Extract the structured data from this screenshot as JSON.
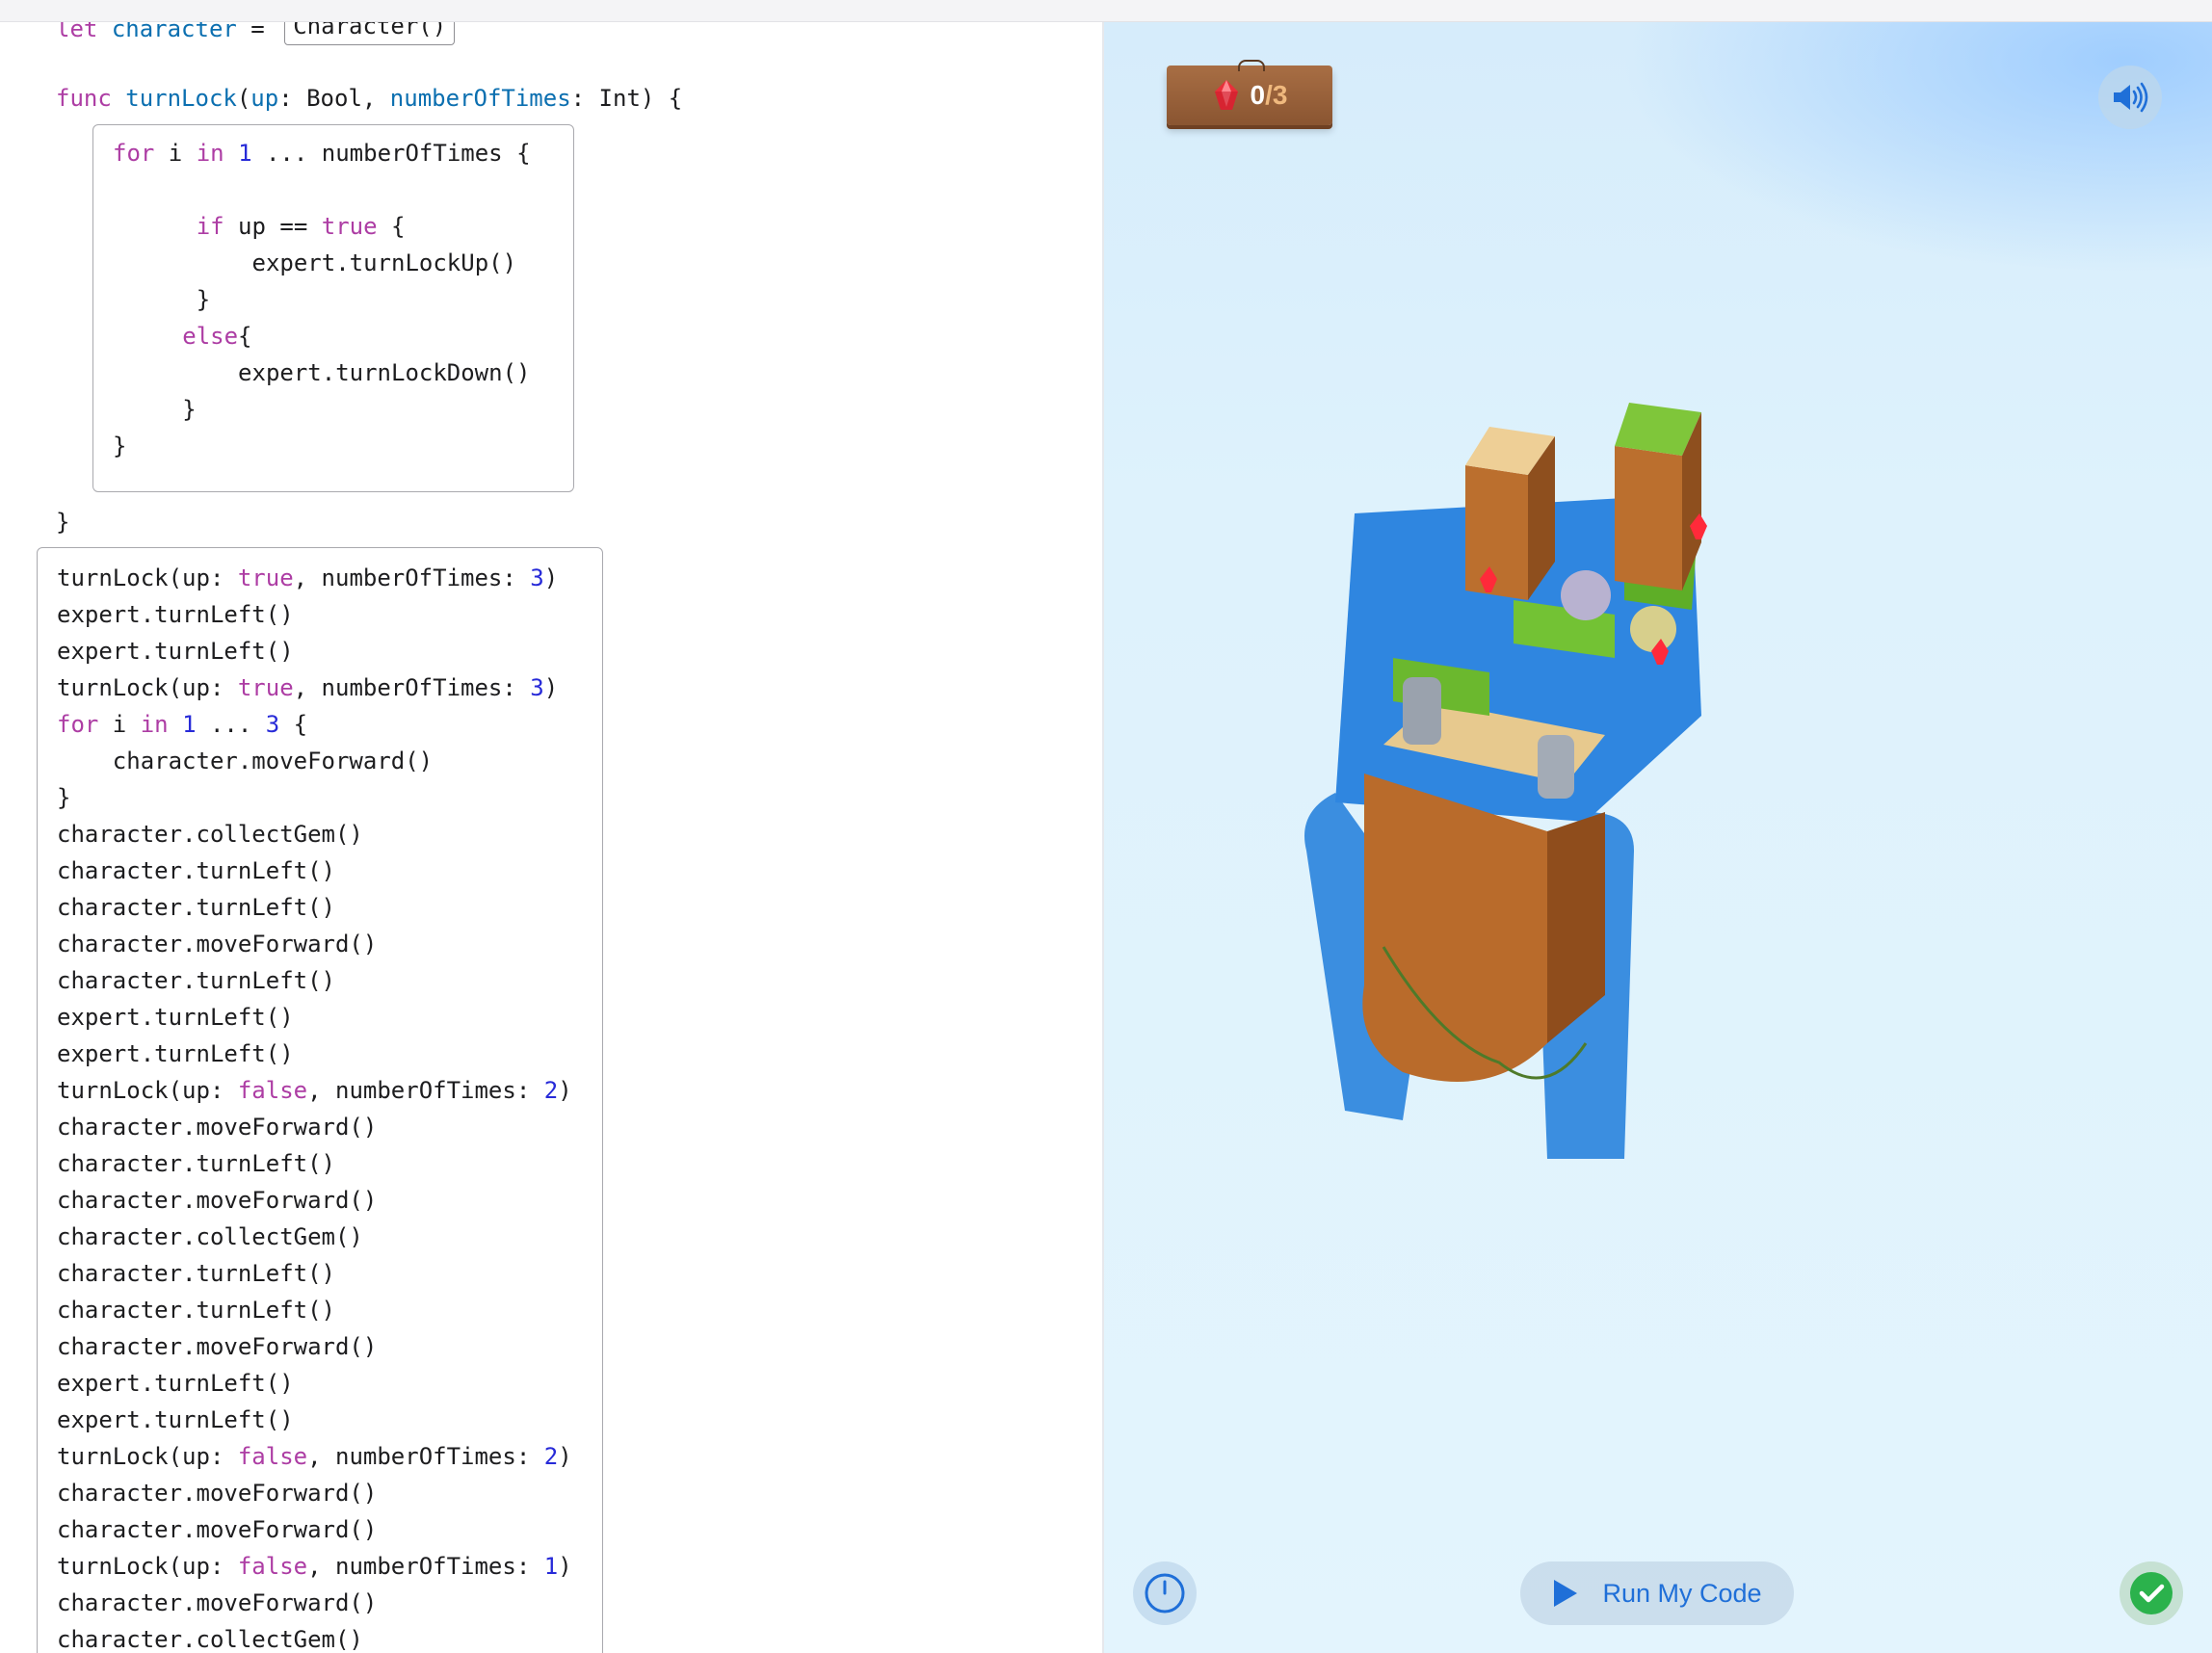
{
  "editor": {
    "header_line": {
      "kw": "let",
      "name": "character",
      "eq": " = ",
      "value": "Character()"
    },
    "func_line": {
      "kw": "func",
      "name": "turnLock",
      "p1": "up",
      "t1": ": Bool, ",
      "p2": "numberOfTimes",
      "t2": ": Int) {"
    },
    "func_body": {
      "for_kw": "for",
      "for_var": " i ",
      "in_kw": "in",
      "one": "1",
      "range_rest": " ... numberOfTimes {",
      "if_kw": "if",
      "if_mid": " up == ",
      "true_kw": "true",
      "if_end": " {",
      "call_up": "expert.turnLockUp()",
      "brace": "}",
      "else_kw": "else",
      "else_brace": "{",
      "call_down": "expert.turnLockDown()"
    },
    "func_close": "}",
    "main_lines": [
      {
        "plain": "turnLock(up: ",
        "kw": "true",
        "mid": ", numberOfTimes: ",
        "num": "3",
        "end": ")"
      },
      {
        "plain": "expert.turnLeft()"
      },
      {
        "plain": "expert.turnLeft()"
      },
      {
        "plain": "turnLock(up: ",
        "kw": "true",
        "mid": ", numberOfTimes: ",
        "num": "3",
        "end": ")"
      },
      {
        "kw0": "for",
        "plain": " i ",
        "kw": "in",
        "mid": " ",
        "num": "1",
        "mid2": " ... ",
        "num2": "3",
        "end": " {"
      },
      {
        "plain": "    character.moveForward()"
      },
      {
        "plain": "}"
      },
      {
        "plain": "character.collectGem()"
      },
      {
        "plain": "character.turnLeft()"
      },
      {
        "plain": "character.turnLeft()"
      },
      {
        "plain": "character.moveForward()"
      },
      {
        "plain": "character.turnLeft()"
      },
      {
        "plain": "expert.turnLeft()"
      },
      {
        "plain": "expert.turnLeft()"
      },
      {
        "plain": "turnLock(up: ",
        "kw": "false",
        "mid": ", numberOfTimes: ",
        "num": "2",
        "end": ")"
      },
      {
        "plain": "character.moveForward()"
      },
      {
        "plain": "character.turnLeft()"
      },
      {
        "plain": "character.moveForward()"
      },
      {
        "plain": "character.collectGem()"
      },
      {
        "plain": "character.turnLeft()"
      },
      {
        "plain": "character.turnLeft()"
      },
      {
        "plain": "character.moveForward()"
      },
      {
        "plain": "expert.turnLeft()"
      },
      {
        "plain": "expert.turnLeft()"
      },
      {
        "plain": "turnLock(up: ",
        "kw": "false",
        "mid": ", numberOfTimes: ",
        "num": "2",
        "end": ")"
      },
      {
        "plain": "character.moveForward()"
      },
      {
        "plain": "character.moveForward()"
      },
      {
        "plain": "turnLock(up: ",
        "kw": "false",
        "mid": ", numberOfTimes: ",
        "num": "1",
        "end": ")"
      },
      {
        "plain": "character.moveForward()"
      },
      {
        "plain": "character.collectGem()"
      }
    ]
  },
  "scene": {
    "gem_counter": {
      "collected": "0",
      "separator": "/",
      "total": "3"
    },
    "run_button_label": "Run My Code",
    "icons": [
      "speaker-icon",
      "gem-icon",
      "speed-gauge-icon",
      "play-icon",
      "checkmark-icon"
    ],
    "colors": {
      "accent": "#1f6fd8",
      "success": "#2bb24c",
      "keyword": "#ad3da4",
      "number": "#272ad8",
      "identifier": "#0b6fb0"
    }
  }
}
